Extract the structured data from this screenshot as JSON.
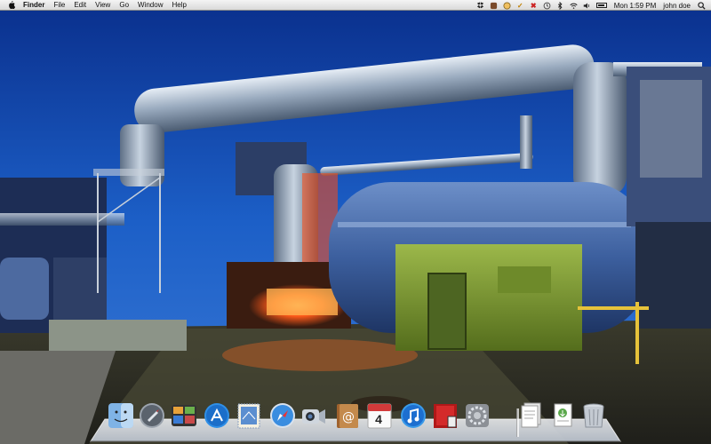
{
  "menubar": {
    "apple_icon": "apple-logo",
    "app_name": "Finder",
    "menus": [
      "File",
      "Edit",
      "View",
      "Go",
      "Window",
      "Help"
    ],
    "status_icons": [
      "dropbox-icon",
      "app-icon",
      "timer-icon",
      "checkmark-icon",
      "x-mark-icon",
      "time-machine-icon",
      "bluetooth-icon",
      "wifi-icon",
      "volume-icon",
      "battery-icon"
    ],
    "clock": "Mon 1:59 PM",
    "user": "john doe",
    "spotlight_icon": "magnifier-icon"
  },
  "desktop": {
    "wallpaper": "industrial-pipes-night-photo"
  },
  "dock": {
    "apps": [
      {
        "name": "Finder",
        "icon": "finder-icon"
      },
      {
        "name": "Launchpad",
        "icon": "rocket-icon"
      },
      {
        "name": "Mission Control",
        "icon": "mission-control-icon"
      },
      {
        "name": "App Store",
        "icon": "app-store-icon"
      },
      {
        "name": "Mail",
        "icon": "mail-stamp-icon"
      },
      {
        "name": "Safari",
        "icon": "compass-icon"
      },
      {
        "name": "FaceTime",
        "icon": "camera-icon"
      },
      {
        "name": "Address Book",
        "icon": "address-book-icon"
      },
      {
        "name": "iCal",
        "icon": "calendar-icon",
        "day": "4"
      },
      {
        "name": "iTunes",
        "icon": "music-note-icon"
      },
      {
        "name": "Photo Booth",
        "icon": "photo-booth-icon"
      },
      {
        "name": "System Preferences",
        "icon": "gear-icon"
      }
    ],
    "stacks": [
      {
        "name": "Documents",
        "icon": "documents-stack-icon"
      },
      {
        "name": "Downloads",
        "icon": "downloads-stack-icon"
      },
      {
        "name": "Trash",
        "icon": "trash-icon"
      }
    ]
  },
  "colors": {
    "sky": "#0f3fa8",
    "pipe": "#9fb0c4",
    "glow": "#ff5a1a",
    "wall_green": "#7fa32a"
  }
}
